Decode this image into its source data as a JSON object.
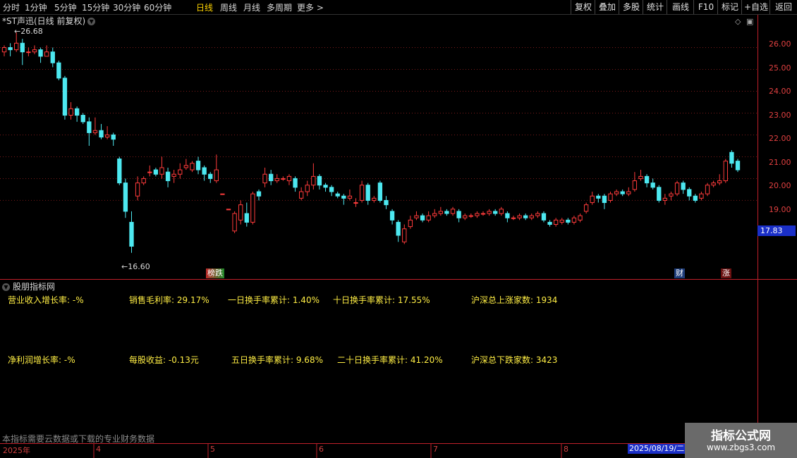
{
  "toolbar": {
    "periods": [
      "分时",
      "1分钟",
      "5分钟",
      "15分钟",
      "30分钟",
      "60分钟",
      "日线",
      "周线",
      "月线",
      "多周期",
      "更多 >"
    ],
    "active_period": "日线",
    "right_buttons": [
      "复权",
      "叠加",
      "多股",
      "统计",
      "画线",
      "F10",
      "标记",
      "+自选",
      "返回"
    ]
  },
  "chart": {
    "title": "*ST声迅(日线 前复权)",
    "high_label": "26.68",
    "low_label": "16.60",
    "current_price": "17.83",
    "y_ticks": [
      "26.00",
      "25.00",
      "24.00",
      "23.00",
      "22.00",
      "21.00",
      "20.00",
      "19.00"
    ],
    "tags": {
      "left": "榜跌",
      "cai": "财",
      "zhang": "涨"
    },
    "colors": {
      "up": "#ff3b3b",
      "down": "#4de8f0",
      "axis": "#c0202a",
      "badge": "#1a2fc8"
    }
  },
  "chart_data": {
    "type": "candlestick",
    "ylim": [
      15.4,
      27.5
    ],
    "max_annot": 26.68,
    "min_annot": 16.6,
    "candles": [
      [
        25.8,
        26.0,
        25.6,
        26.1
      ],
      [
        26.0,
        25.9,
        25.6,
        26.2
      ],
      [
        25.9,
        26.2,
        25.8,
        26.7
      ],
      [
        26.2,
        25.8,
        25.2,
        26.4
      ],
      [
        25.8,
        25.8,
        25.6,
        26.0
      ],
      [
        25.8,
        25.9,
        25.7,
        26.1
      ],
      [
        25.9,
        25.6,
        25.3,
        26.0
      ],
      [
        25.6,
        25.8,
        25.6,
        26.1
      ],
      [
        25.8,
        25.3,
        25.1,
        26.0
      ],
      [
        25.3,
        24.6,
        24.5,
        25.4
      ],
      [
        24.6,
        22.9,
        22.7,
        24.7
      ],
      [
        22.9,
        23.2,
        22.7,
        23.5
      ],
      [
        23.2,
        22.9,
        22.6,
        23.3
      ],
      [
        22.9,
        22.6,
        22.5,
        23.0
      ],
      [
        22.6,
        22.1,
        21.5,
        22.8
      ],
      [
        22.1,
        22.2,
        22.0,
        22.8
      ],
      [
        22.2,
        21.9,
        21.8,
        22.5
      ],
      [
        21.9,
        22.0,
        21.8,
        22.4
      ],
      [
        22.0,
        21.8,
        21.5,
        22.1
      ],
      [
        20.9,
        19.8,
        19.7,
        21.0
      ],
      [
        19.8,
        18.5,
        18.2,
        20.0
      ],
      [
        18.0,
        16.9,
        16.6,
        18.5
      ],
      [
        19.2,
        19.8,
        19.0,
        20.1
      ],
      [
        19.8,
        20.0,
        19.7,
        20.1
      ],
      [
        20.3,
        20.3,
        20.1,
        20.6
      ],
      [
        20.4,
        20.2,
        20.1,
        20.5
      ],
      [
        20.2,
        20.5,
        20.0,
        21.0
      ],
      [
        20.3,
        19.9,
        19.6,
        20.5
      ],
      [
        20.1,
        20.2,
        19.8,
        20.4
      ],
      [
        20.2,
        20.4,
        20.0,
        20.7
      ],
      [
        20.5,
        20.6,
        20.4,
        20.9
      ],
      [
        20.4,
        20.7,
        20.3,
        20.8
      ],
      [
        20.8,
        20.4,
        20.2,
        21.0
      ],
      [
        20.5,
        20.2,
        19.9,
        20.6
      ],
      [
        20.2,
        20.0,
        19.8,
        20.3
      ],
      [
        19.9,
        20.4,
        19.8,
        21.1
      ],
      [
        19.3,
        19.3,
        19.3,
        19.3
      ],
      [
        18.6,
        18.6,
        18.6,
        18.6
      ],
      [
        17.6,
        18.4,
        17.5,
        18.5
      ],
      [
        18.1,
        18.8,
        17.9,
        19.0
      ],
      [
        18.4,
        18.0,
        17.8,
        18.9
      ],
      [
        18.0,
        19.3,
        17.9,
        19.4
      ],
      [
        19.4,
        19.2,
        19.0,
        19.5
      ],
      [
        19.8,
        20.2,
        19.6,
        20.5
      ],
      [
        20.2,
        19.9,
        19.7,
        20.4
      ],
      [
        19.9,
        20.0,
        19.8,
        20.2
      ],
      [
        20.0,
        20.0,
        19.9,
        20.1
      ],
      [
        19.9,
        20.1,
        19.7,
        20.2
      ],
      [
        20.0,
        19.6,
        19.4,
        20.1
      ],
      [
        19.1,
        19.4,
        19.0,
        19.6
      ],
      [
        19.4,
        19.7,
        19.2,
        19.9
      ],
      [
        19.7,
        20.1,
        19.5,
        20.7
      ],
      [
        20.1,
        19.7,
        19.5,
        20.2
      ],
      [
        19.7,
        19.6,
        19.4,
        19.8
      ],
      [
        19.6,
        19.4,
        19.2,
        19.7
      ],
      [
        19.3,
        19.2,
        19.1,
        19.4
      ],
      [
        19.2,
        19.1,
        18.8,
        19.3
      ],
      [
        19.1,
        19.2,
        19.0,
        19.5
      ],
      [
        18.9,
        18.9,
        18.7,
        19.1
      ],
      [
        19.0,
        19.7,
        18.9,
        19.9
      ],
      [
        19.7,
        19.0,
        18.8,
        19.8
      ],
      [
        19.0,
        19.1,
        18.9,
        19.2
      ],
      [
        19.8,
        19.0,
        18.9,
        19.9
      ],
      [
        19.0,
        18.8,
        18.6,
        19.2
      ],
      [
        18.5,
        18.1,
        17.9,
        18.6
      ],
      [
        18.0,
        17.4,
        17.1,
        18.1
      ],
      [
        17.1,
        17.7,
        17.0,
        17.9
      ],
      [
        17.8,
        18.1,
        17.7,
        18.3
      ],
      [
        18.2,
        18.3,
        18.1,
        18.5
      ],
      [
        18.3,
        18.1,
        18.0,
        18.4
      ],
      [
        18.1,
        18.3,
        18.0,
        18.5
      ],
      [
        18.3,
        18.4,
        18.2,
        18.6
      ],
      [
        18.4,
        18.5,
        18.3,
        18.7
      ],
      [
        18.5,
        18.4,
        18.3,
        18.6
      ],
      [
        18.4,
        18.6,
        18.3,
        18.7
      ],
      [
        18.5,
        18.2,
        18.0,
        18.6
      ],
      [
        18.2,
        18.3,
        18.1,
        18.4
      ],
      [
        18.3,
        18.3,
        18.2,
        18.4
      ],
      [
        18.3,
        18.4,
        18.2,
        18.5
      ],
      [
        18.4,
        18.4,
        18.3,
        18.5
      ],
      [
        18.4,
        18.5,
        18.3,
        18.6
      ],
      [
        18.5,
        18.4,
        18.3,
        18.6
      ],
      [
        18.4,
        18.6,
        18.3,
        18.7
      ],
      [
        18.4,
        18.2,
        18.0,
        18.5
      ],
      [
        18.2,
        18.2,
        18.1,
        18.3
      ],
      [
        18.2,
        18.3,
        18.1,
        18.4
      ],
      [
        18.3,
        18.2,
        18.1,
        18.4
      ],
      [
        18.2,
        18.3,
        18.1,
        18.4
      ],
      [
        18.3,
        18.4,
        18.2,
        18.5
      ],
      [
        18.4,
        18.1,
        18.0,
        18.5
      ],
      [
        18.0,
        17.9,
        17.8,
        18.1
      ],
      [
        17.9,
        18.1,
        17.8,
        18.2
      ],
      [
        18.0,
        18.1,
        17.9,
        18.2
      ],
      [
        18.1,
        18.0,
        17.9,
        18.2
      ],
      [
        18.0,
        18.2,
        17.9,
        18.3
      ],
      [
        18.1,
        18.3,
        18.0,
        18.4
      ],
      [
        18.5,
        18.8,
        18.4,
        18.9
      ],
      [
        18.9,
        19.2,
        18.8,
        19.4
      ],
      [
        19.2,
        19.1,
        18.9,
        19.3
      ],
      [
        19.2,
        18.9,
        18.6,
        19.3
      ],
      [
        19.0,
        19.3,
        18.9,
        19.4
      ],
      [
        19.3,
        19.4,
        19.2,
        19.5
      ],
      [
        19.4,
        19.3,
        19.2,
        19.5
      ],
      [
        19.3,
        19.4,
        19.2,
        19.6
      ],
      [
        19.5,
        19.9,
        19.4,
        20.3
      ],
      [
        20.0,
        20.1,
        19.9,
        20.4
      ],
      [
        20.1,
        19.8,
        19.6,
        20.2
      ],
      [
        19.8,
        19.6,
        19.5,
        20.0
      ],
      [
        19.6,
        19.0,
        18.9,
        19.7
      ],
      [
        19.0,
        19.1,
        18.8,
        19.3
      ],
      [
        19.2,
        19.3,
        19.0,
        19.4
      ],
      [
        19.3,
        19.8,
        19.2,
        19.9
      ],
      [
        19.8,
        19.5,
        19.3,
        19.9
      ],
      [
        19.5,
        19.2,
        19.0,
        19.6
      ],
      [
        19.2,
        19.0,
        18.9,
        19.3
      ],
      [
        19.1,
        19.3,
        19.0,
        19.4
      ],
      [
        19.3,
        19.7,
        19.2,
        19.8
      ],
      [
        19.7,
        19.8,
        19.6,
        19.9
      ],
      [
        19.8,
        19.9,
        19.7,
        20.2
      ],
      [
        19.9,
        20.8,
        19.8,
        20.9
      ],
      [
        21.2,
        20.7,
        20.5,
        21.3
      ],
      [
        20.8,
        20.4,
        20.3,
        20.9
      ]
    ]
  },
  "panel": {
    "title": "股朋指标网",
    "row1": [
      "营业收入增长率: -%",
      "销售毛利率: 29.17%",
      "一日换手率累计: 1.40%",
      "十日换手率累计: 17.55%",
      "沪深总上涨家数: 1934"
    ],
    "row2": [
      "净利润增长率: -%",
      "每股收益: -0.13元",
      "五日换手率累计: 9.68%",
      "二十日换手率累计: 41.20%",
      "沪深总下跌家数: 3423"
    ],
    "note": "本指标需要云数据或下载的专业财务数据"
  },
  "timeline": {
    "labels": [
      "2025年",
      "4",
      "5",
      "6",
      "7",
      "8"
    ],
    "current_date": "2025/08/19/二"
  },
  "watermark": {
    "title": "指标公式网",
    "url": "www.zbgs3.com"
  }
}
